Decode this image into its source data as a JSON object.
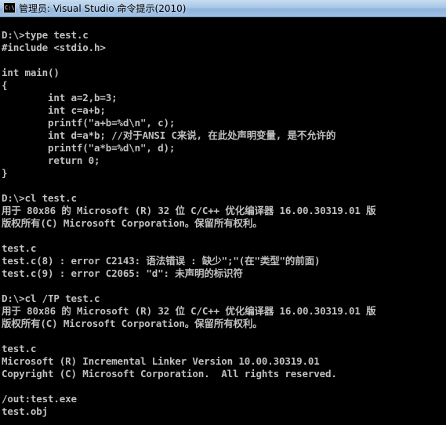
{
  "window": {
    "title": "管理员: Visual Studio 命令提示(2010)",
    "icon_name": "console-app-icon",
    "icon_glyph": "C:\\"
  },
  "console": {
    "text_color": "#c0c0c0",
    "background": "#000000",
    "lines": [
      "D:\\>type test.c",
      "#include <stdio.h>",
      "",
      "int main()",
      "{",
      "        int a=2,b=3;",
      "        int c=a+b;",
      "        printf(\"a+b=%d\\n\", c);",
      "        int d=a*b; //对于ANSI C来说, 在此处声明变量, 是不允许的",
      "        printf(\"a*b=%d\\n\", d);",
      "        return 0;",
      "}",
      "",
      "D:\\>cl test.c",
      "用于 80x86 的 Microsoft (R) 32 位 C/C++ 优化编译器 16.00.30319.01 版",
      "版权所有(C) Microsoft Corporation。保留所有权利。",
      "",
      "test.c",
      "test.c(8) : error C2143: 语法错误 : 缺少\";\"(在\"类型\"的前面)",
      "test.c(9) : error C2065: \"d\": 未声明的标识符",
      "",
      "D:\\>cl /TP test.c",
      "用于 80x86 的 Microsoft (R) 32 位 C/C++ 优化编译器 16.00.30319.01 版",
      "版权所有(C) Microsoft Corporation。保留所有权利。",
      "",
      "test.c",
      "Microsoft (R) Incremental Linker Version 10.00.30319.01",
      "Copyright (C) Microsoft Corporation.  All rights reserved.",
      "",
      "/out:test.exe",
      "test.obj"
    ]
  }
}
